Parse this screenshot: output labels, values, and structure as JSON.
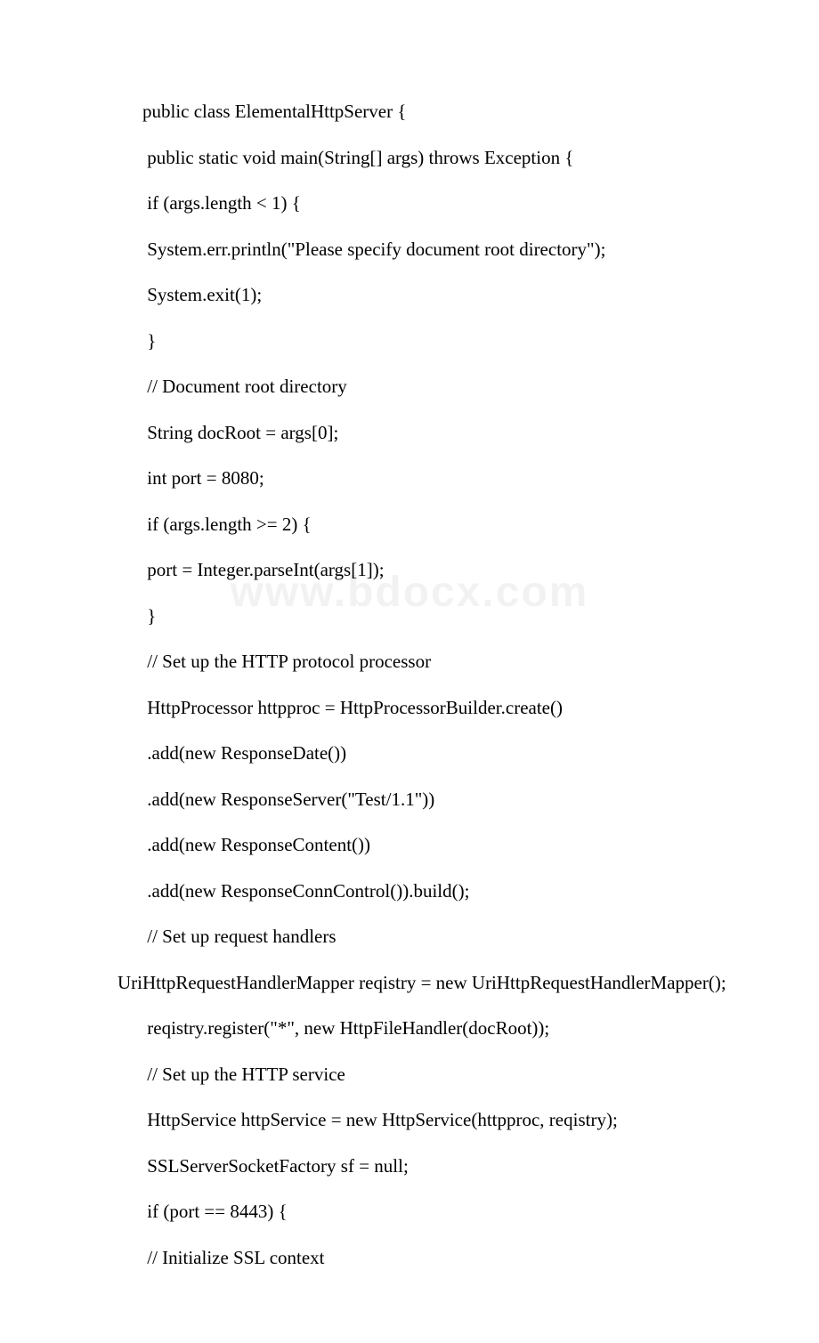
{
  "watermark": "www.bdocx.com",
  "lines": [
    {
      "indent": "indent1",
      "text": "public class ElementalHttpServer {"
    },
    {
      "indent": "indent1",
      "text": " public static void main(String[] args) throws Exception {"
    },
    {
      "indent": "indent1",
      "text": " if (args.length < 1) {"
    },
    {
      "indent": "indent1",
      "text": " System.err.println(\"Please specify document root directory\");"
    },
    {
      "indent": "indent1",
      "text": " System.exit(1);"
    },
    {
      "indent": "indent1",
      "text": " }"
    },
    {
      "indent": "indent1",
      "text": " // Document root directory"
    },
    {
      "indent": "indent1",
      "text": " String docRoot = args[0];"
    },
    {
      "indent": "indent1",
      "text": " int port = 8080;"
    },
    {
      "indent": "indent1",
      "text": " if (args.length >= 2) {"
    },
    {
      "indent": "indent1",
      "text": " port = Integer.parseInt(args[1]);"
    },
    {
      "indent": "indent1",
      "text": " }"
    },
    {
      "indent": "indent1",
      "text": " // Set up the HTTP protocol processor"
    },
    {
      "indent": "indent1",
      "text": " HttpProcessor httpproc = HttpProcessorBuilder.create()"
    },
    {
      "indent": "indent1",
      "text": " .add(new ResponseDate())"
    },
    {
      "indent": "indent1",
      "text": " .add(new ResponseServer(\"Test/1.1\"))"
    },
    {
      "indent": "indent1",
      "text": " .add(new ResponseContent())"
    },
    {
      "indent": "indent1",
      "text": " .add(new ResponseConnControl()).build();"
    },
    {
      "indent": "indent1",
      "text": " // Set up request handlers"
    },
    {
      "indent": "indent0",
      "text": "        UriHttpRequestHandlerMapper reqistry = new UriHttpRequestHandlerMapper();"
    },
    {
      "indent": "indent1",
      "text": " reqistry.register(\"*\", new HttpFileHandler(docRoot));"
    },
    {
      "indent": "indent1",
      "text": " // Set up the HTTP service"
    },
    {
      "indent": "indent1",
      "text": " HttpService httpService = new HttpService(httpproc, reqistry);"
    },
    {
      "indent": "indent1",
      "text": " SSLServerSocketFactory sf = null;"
    },
    {
      "indent": "indent1",
      "text": " if (port == 8443) {"
    },
    {
      "indent": "indent1",
      "text": " // Initialize SSL context"
    }
  ]
}
